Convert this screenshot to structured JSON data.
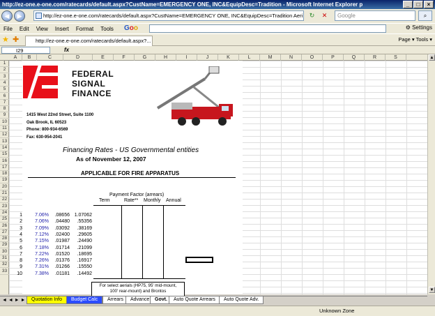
{
  "window": {
    "title": "http://ez-one.e-one.com/ratecards/default.aspx?CustName=EMERGENCY ONE, INC&EquipDesc=Tradition - Microsoft Internet Explorer p"
  },
  "nav": {
    "url": "http://ez-one.e-one.com/ratecards/default.aspx?CustName=EMERGENCY ONE, INC&EquipDesc=Tradition Aeri",
    "search_placeholder": "Google"
  },
  "menu": {
    "items": [
      "File",
      "Edit",
      "View",
      "Insert",
      "Format",
      "Tools"
    ],
    "settings": "Settings"
  },
  "tab": {
    "label": "http://ez-one.e-one.com/ratecards/default.aspx?...",
    "tools": "Page ▾  Tools ▾"
  },
  "formula": {
    "cell": "I29",
    "fx": "fx"
  },
  "columns": [
    "A",
    "B",
    "C",
    "D",
    "E",
    "F",
    "G",
    "H",
    "I",
    "J",
    "K",
    "L",
    "M",
    "N",
    "O",
    "P",
    "Q",
    "R",
    "S"
  ],
  "rows": [
    "1",
    "2",
    "3",
    "4",
    "5",
    "6",
    "7",
    "8",
    "9",
    "10",
    "11",
    "12",
    "13",
    "14",
    "15",
    "16",
    "17",
    "18",
    "19",
    "20",
    "21",
    "22",
    "23",
    "24",
    "25",
    "26",
    "27",
    "28",
    "29",
    "30",
    "31",
    "32",
    "33"
  ],
  "company": {
    "line1": "FEDERAL",
    "line2": "SIGNAL",
    "line3": "FINANCE"
  },
  "address": [
    "1415 West 22nd Street, Suite 1100",
    "Oak Brook, IL  60523",
    "Phone:  800-934-6569",
    "Fax:        630-954-2041"
  ],
  "heading": {
    "title": "Financing Rates - US Governmental entities",
    "date": "As of November 12, 2007",
    "subtitle": "APPLICABLE FOR FIRE APPARATUS"
  },
  "table": {
    "caption": "Payment Factor (arrears)",
    "headers": [
      "Term",
      "Rate**",
      "Monthly",
      "Annual"
    ],
    "rows": [
      [
        "1",
        "7.06%",
        ".08656",
        "1.07062"
      ],
      [
        "2",
        "7.06%",
        ".04480",
        ".55356"
      ],
      [
        "3",
        "7.09%",
        ".03092",
        ".38169"
      ],
      [
        "4",
        "7.12%",
        ".02400",
        ".29605"
      ],
      [
        "5",
        "7.15%",
        ".01987",
        ".24490"
      ],
      [
        "6",
        "7.18%",
        ".01714",
        ".21099"
      ],
      [
        "7",
        "7.22%",
        ".01520",
        ".18695"
      ],
      [
        "8",
        "7.26%",
        ".01376",
        ".16917"
      ],
      [
        "9",
        "7.31%",
        ".01266",
        ".15550"
      ],
      [
        "10",
        "7.38%",
        ".01181",
        ".14492"
      ]
    ]
  },
  "note": {
    "line1": "For select aerials (HP75, 95' mid-mount,",
    "line2": "100' rear-mount) and Brontos"
  },
  "sheet_tabs": [
    "Quotation Info",
    "Budget Calc",
    "Arrears",
    "Advance",
    "Govt.",
    "Auto Quote Arrears",
    "Auto Quote Adv."
  ],
  "status": {
    "zone": "Unknown Zone"
  },
  "colors": {
    "logo_red": "#e8101a",
    "rate_blue": "#1a1aa8",
    "tab_yellow": "#ffff00",
    "tab_blue": "#2b4cff"
  }
}
